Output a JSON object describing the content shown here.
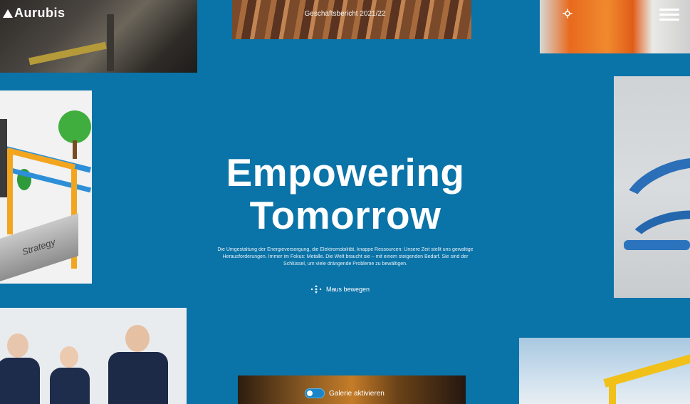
{
  "brand": {
    "logo_text": "Aurubis"
  },
  "header": {
    "report_label": "Geschäftsbericht 2021/22",
    "settings_icon": "gear-icon",
    "menu_icon": "menu-icon"
  },
  "hero": {
    "title_line1": "Empowering",
    "title_line2": "Tomorrow",
    "description": "Die Umgestaltung der Energieversorgung, die Elektromobilität, knappe Ressourcen: Unsere Zeit stellt uns gewaltige Herausforderungen. Immer im Fokus: Metalle. Die Welt braucht sie – mit einem steigenden Bedarf. Sie sind der Schlüssel, um viele drängende Probleme zu bewältigen.",
    "hint_label": "Maus bewegen",
    "hint_icon": "mouse-move-icon"
  },
  "gallery": {
    "toggle_label": "Galerie aktivieren",
    "strategy_tile_label": "Strategy"
  },
  "colors": {
    "background": "#0a73a8",
    "text": "#ffffff"
  }
}
